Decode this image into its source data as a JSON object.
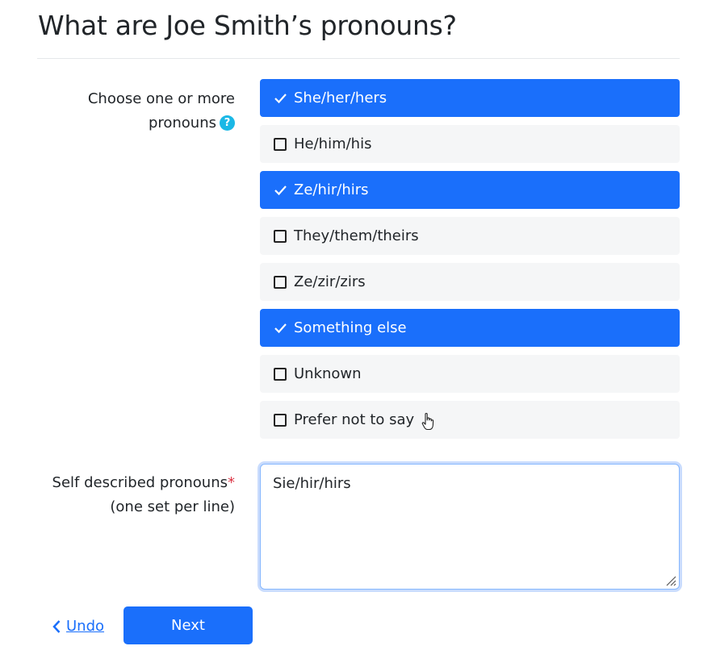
{
  "header": {
    "title": "What are Joe Smith’s pronouns?"
  },
  "pronouns": {
    "label": "Choose one or more pronouns",
    "help_icon": "?",
    "options": [
      {
        "label": "She/her/hers",
        "checked": true
      },
      {
        "label": "He/him/his",
        "checked": false
      },
      {
        "label": "Ze/hir/hirs",
        "checked": true
      },
      {
        "label": "They/them/theirs",
        "checked": false
      },
      {
        "label": "Ze/zir/zirs",
        "checked": false
      },
      {
        "label": "Something else",
        "checked": true
      },
      {
        "label": "Unknown",
        "checked": false
      },
      {
        "label": "Prefer not to say",
        "checked": false
      }
    ]
  },
  "self_described": {
    "label": "Self described pronouns",
    "required_marker": "*",
    "sublabel": "(one set per line)",
    "value": "Sie/hir/hirs"
  },
  "actions": {
    "undo_label": "Undo",
    "next_label": "Next"
  },
  "colors": {
    "accent": "#1a6ffb",
    "unchecked_bg": "#f5f6f7",
    "help_icon": "#1ab8e6",
    "required": "#dc3545"
  }
}
